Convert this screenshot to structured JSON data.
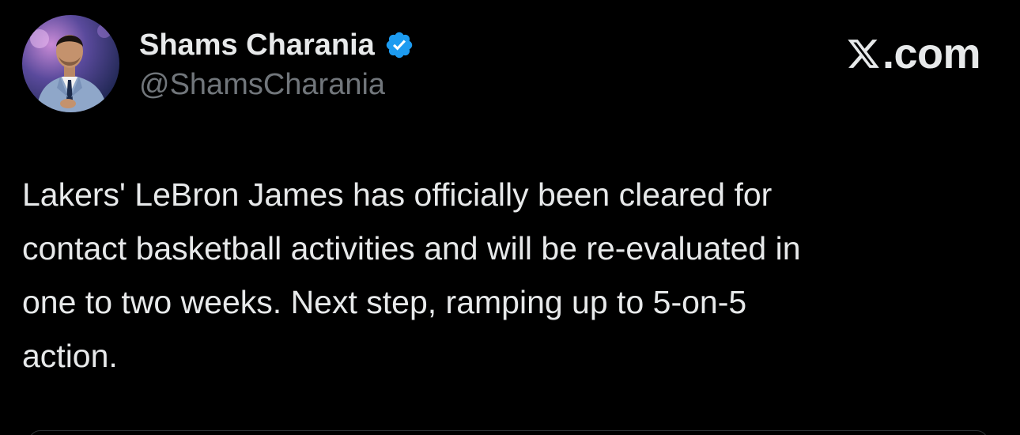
{
  "author": {
    "display_name": "Shams Charania",
    "handle": "@ShamsCharania",
    "verified": true,
    "verified_color": "#1d9bf0",
    "avatar_icon": "profile-photo"
  },
  "brand": {
    "icon": "x-logo-icon",
    "suffix": ".com"
  },
  "tweet": {
    "text_lines": [
      "Lakers' LeBron James has officially been cleared for",
      "contact basketball activities and will be re-evaluated in",
      "one to two weeks. Next step, ramping up to 5-on-5",
      "action."
    ]
  },
  "colors": {
    "background": "#000000",
    "primary_text": "#e7e9ea",
    "secondary_text": "#71767b",
    "accent": "#1d9bf0"
  }
}
